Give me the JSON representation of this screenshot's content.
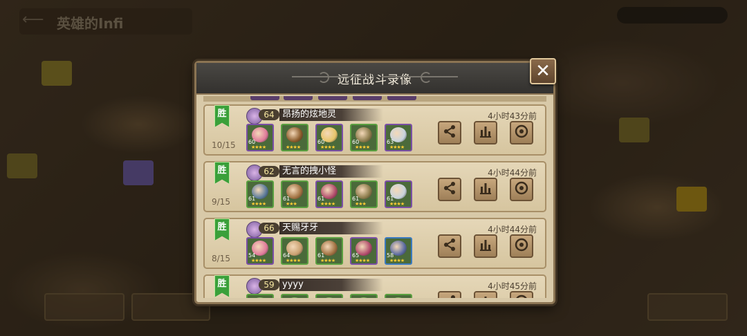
{
  "modal": {
    "title": "远征战斗录像",
    "close_icon": "close-icon"
  },
  "background": {
    "title": "英雄的Infi"
  },
  "records": [
    {
      "result": "胜",
      "progress": "10/15",
      "level": "64",
      "name": "昂扬的炫地灵",
      "time": "4小时43分前",
      "heroes": [
        {
          "level": "60",
          "stars": "★★★★",
          "frame": "purple",
          "color": "#e07a9a"
        },
        {
          "level": "",
          "stars": "★★★★",
          "frame": "green",
          "color": "#8a5a2a"
        },
        {
          "level": "60",
          "stars": "★★★★",
          "frame": "purple",
          "color": "#e8c56a"
        },
        {
          "level": "60",
          "stars": "★★★★",
          "frame": "green",
          "color": "#8a7a4a"
        },
        {
          "level": "63",
          "stars": "★★★★",
          "frame": "purple",
          "color": "#c9d4dd"
        }
      ]
    },
    {
      "result": "胜",
      "progress": "9/15",
      "level": "62",
      "name": "无言的拽小怪",
      "time": "4小时44分前",
      "heroes": [
        {
          "level": "61",
          "stars": "★★★★",
          "frame": "green",
          "color": "#5a7a9a"
        },
        {
          "level": "61",
          "stars": "★★★",
          "frame": "green",
          "color": "#a07040"
        },
        {
          "level": "61",
          "stars": "★★★★",
          "frame": "purple",
          "color": "#b04a6a"
        },
        {
          "level": "61",
          "stars": "★★★",
          "frame": "green",
          "color": "#8a7a4a"
        },
        {
          "level": "61",
          "stars": "★★★★",
          "frame": "purple",
          "color": "#c9d4dd"
        }
      ]
    },
    {
      "result": "胜",
      "progress": "8/15",
      "level": "66",
      "name": "天赐牙牙",
      "time": "4小时44分前",
      "heroes": [
        {
          "level": "54",
          "stars": "★★★★",
          "frame": "purple",
          "color": "#e07a9a"
        },
        {
          "level": "64",
          "stars": "★★★★",
          "frame": "green",
          "color": "#c9a070"
        },
        {
          "level": "61",
          "stars": "★★★★",
          "frame": "green",
          "color": "#a07040"
        },
        {
          "level": "65",
          "stars": "★★★★",
          "frame": "purple",
          "color": "#b04a6a"
        },
        {
          "level": "58",
          "stars": "★★★★",
          "frame": "blue",
          "color": "#5a6aa0"
        }
      ]
    },
    {
      "result": "胜",
      "progress": "",
      "level": "59",
      "name": "yyyy",
      "time": "4小时45分前",
      "heroes": []
    }
  ],
  "actions": {
    "share_icon": "share-icon",
    "stats_icon": "bar-chart-icon",
    "replay_icon": "replay-icon"
  }
}
